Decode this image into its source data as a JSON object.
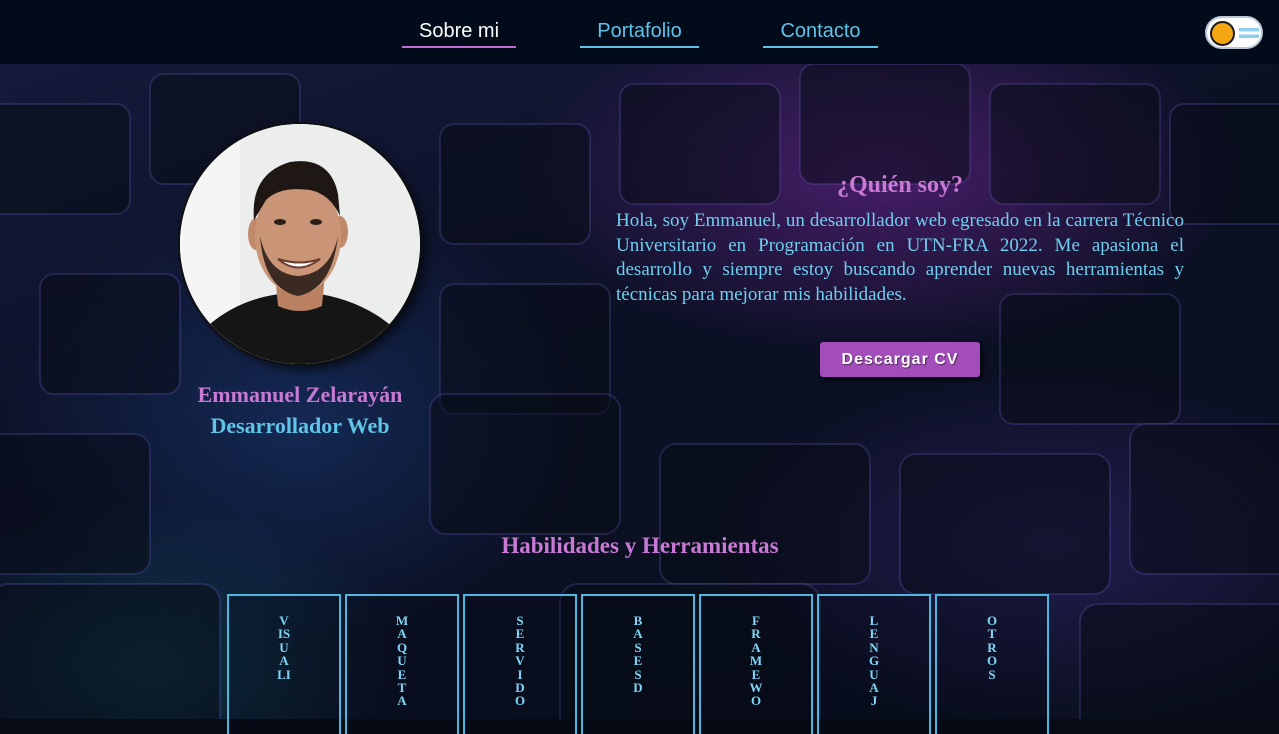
{
  "nav": {
    "links": [
      {
        "label": "Sobre mi",
        "active": true
      },
      {
        "label": "Portafolio",
        "active": false
      },
      {
        "label": "Contacto",
        "active": false
      }
    ],
    "theme_toggle": {
      "icons": [
        "sun-icon",
        "argentina-flag-icon"
      ]
    }
  },
  "profile": {
    "name": "Emmanuel Zelarayán",
    "role": "Desarrollador Web"
  },
  "about": {
    "title": "¿Quién soy?",
    "text": "Hola, soy Emmanuel, un desarrollador web egresado en la carrera Técnico Universitario en Programación en UTN-FRA 2022. Me apasiona el desarrollo y siempre estoy buscando aprender nuevas herramientas y técnicas para mejorar mis habilidades.",
    "cv_button": "Descargar CV"
  },
  "skills": {
    "title": "Habilidades y Herramientas",
    "cards": [
      "VISUALI",
      "MAQUETA",
      "SERVIDO",
      "BASES D",
      "FRAMEWO",
      "LENGUAJ",
      "OTROS"
    ]
  },
  "colors": {
    "accent_purple": "#c879d4",
    "accent_cyan": "#5ec5e6",
    "button": "#a34dbb",
    "navbar": "#020b19"
  }
}
